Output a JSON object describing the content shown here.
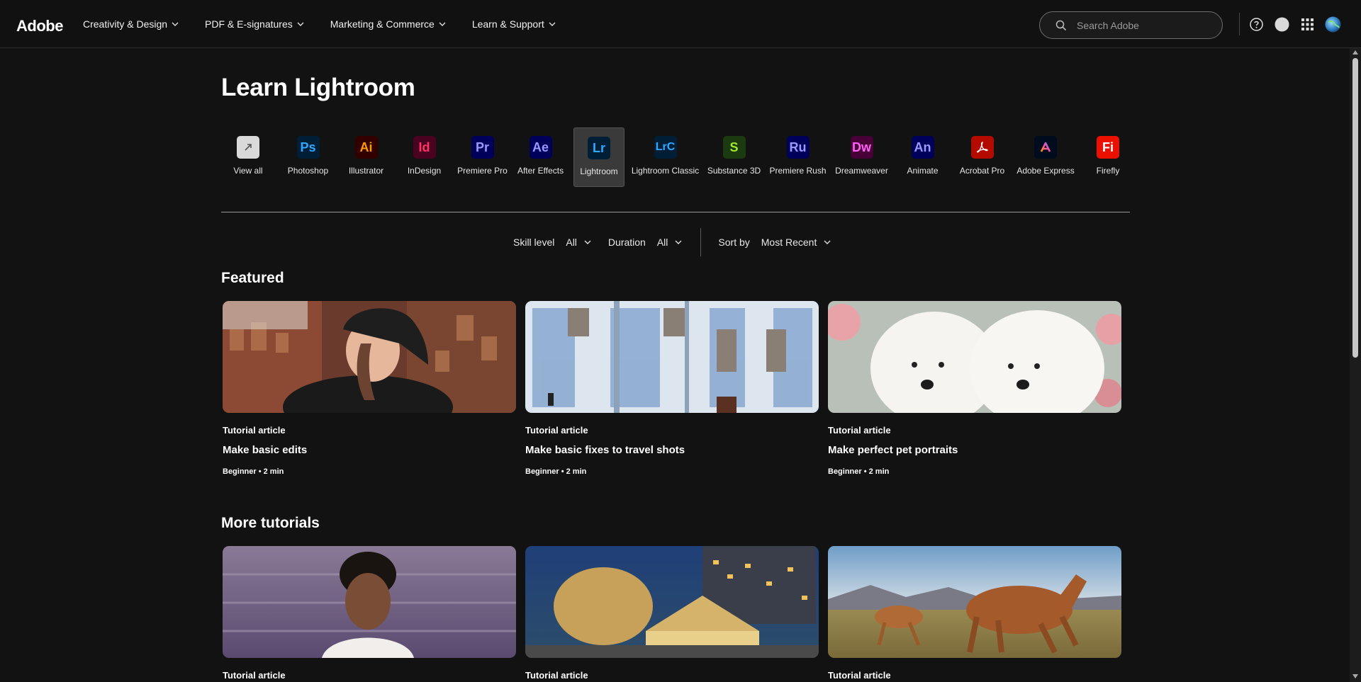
{
  "nav": {
    "logo": "Adobe",
    "links": [
      {
        "label": "Creativity & Design"
      },
      {
        "label": "PDF & E-signatures"
      },
      {
        "label": "Marketing & Commerce"
      },
      {
        "label": "Learn & Support"
      }
    ],
    "search_placeholder": "Search Adobe"
  },
  "page": {
    "title": "Learn Lightroom"
  },
  "apps": [
    {
      "label": "View all",
      "abbr": "",
      "bg": "#d9d9d9",
      "fg": "#444444"
    },
    {
      "label": "Photoshop",
      "abbr": "Ps",
      "bg": "#001e36",
      "fg": "#31a8ff"
    },
    {
      "label": "Illustrator",
      "abbr": "Ai",
      "bg": "#330000",
      "fg": "#ff9a00"
    },
    {
      "label": "InDesign",
      "abbr": "Id",
      "bg": "#49021f",
      "fg": "#ff3366"
    },
    {
      "label": "Premiere Pro",
      "abbr": "Pr",
      "bg": "#00005b",
      "fg": "#9999ff"
    },
    {
      "label": "After Effects",
      "abbr": "Ae",
      "bg": "#00005b",
      "fg": "#9999ff"
    },
    {
      "label": "Lightroom",
      "abbr": "Lr",
      "bg": "#001e36",
      "fg": "#31a8ff",
      "selected": true
    },
    {
      "label": "Lightroom Classic",
      "abbr": "LrC",
      "bg": "#001e36",
      "fg": "#31a8ff"
    },
    {
      "label": "Substance 3D",
      "abbr": "S",
      "bg": "#1b3a0f",
      "fg": "#a2e82b"
    },
    {
      "label": "Premiere Rush",
      "abbr": "Ru",
      "bg": "#00005b",
      "fg": "#9999ff"
    },
    {
      "label": "Dreamweaver",
      "abbr": "Dw",
      "bg": "#470137",
      "fg": "#ff61f6"
    },
    {
      "label": "Animate",
      "abbr": "An",
      "bg": "#00005b",
      "fg": "#9999ff"
    },
    {
      "label": "Acrobat Pro",
      "abbr": "",
      "bg": "#b30b00",
      "fg": "#ffffff"
    },
    {
      "label": "Adobe Express",
      "abbr": "",
      "bg": "#000b1d",
      "fg": "#ff4f9e"
    },
    {
      "label": "Firefly",
      "abbr": "Fi",
      "bg": "#eb1000",
      "fg": "#ffffff"
    }
  ],
  "filters": {
    "skill_label": "Skill level",
    "skill_value": "All",
    "duration_label": "Duration",
    "duration_value": "All",
    "sort_label": "Sort by",
    "sort_value": "Most Recent"
  },
  "featured": {
    "title": "Featured",
    "cards": [
      {
        "type": "Tutorial article",
        "title": "Make basic edits",
        "meta": "Beginner • 2 min"
      },
      {
        "type": "Tutorial article",
        "title": "Make basic fixes to travel shots",
        "meta": "Beginner • 2 min"
      },
      {
        "type": "Tutorial article",
        "title": "Make perfect pet portraits",
        "meta": "Beginner • 2 min"
      }
    ]
  },
  "more": {
    "title": "More tutorials",
    "cards": [
      {
        "type": "Tutorial article"
      },
      {
        "type": "Tutorial article"
      },
      {
        "type": "Tutorial article"
      }
    ]
  },
  "colors": {
    "background": "#121212",
    "nav": "#111111",
    "selected_tile": "#3a3a3a"
  }
}
